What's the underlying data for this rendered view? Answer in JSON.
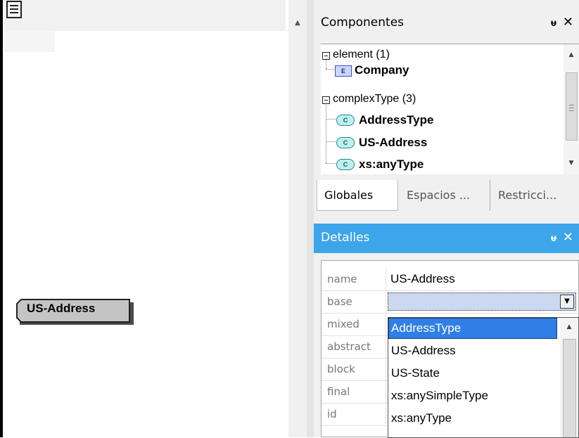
{
  "design_view": {
    "component_label": "US-Address"
  },
  "components_panel": {
    "title": "Componentes",
    "pin_icon": "pin-icon",
    "close_icon": "close-icon",
    "tree": {
      "groups": [
        {
          "label": "element (1)",
          "items": [
            {
              "badge": "E",
              "label": "Company"
            }
          ]
        },
        {
          "label": "complexType (3)",
          "items": [
            {
              "badge": "C",
              "label": "AddressType"
            },
            {
              "badge": "C",
              "label": "US-Address"
            },
            {
              "badge": "C",
              "label": "xs:anyType"
            }
          ]
        }
      ]
    },
    "tabs": [
      {
        "label": "Globales",
        "active": true
      },
      {
        "label": "Espacios ...",
        "active": false
      },
      {
        "label": "Restricci...",
        "active": false
      }
    ]
  },
  "details_panel": {
    "title": "Detalles",
    "accent_color": "#3da5ea",
    "properties": [
      {
        "name": "name",
        "value": "US-Address"
      },
      {
        "name": "base",
        "value": ""
      },
      {
        "name": "mixed",
        "value": ""
      },
      {
        "name": "abstract",
        "value": ""
      },
      {
        "name": "block",
        "value": ""
      },
      {
        "name": "final",
        "value": ""
      },
      {
        "name": "id",
        "value": ""
      }
    ],
    "base_dropdown": {
      "selected_index": 0,
      "options": [
        "AddressType",
        "US-Address",
        "US-State",
        "xs:anySimpleType",
        "xs:anyType"
      ]
    }
  }
}
